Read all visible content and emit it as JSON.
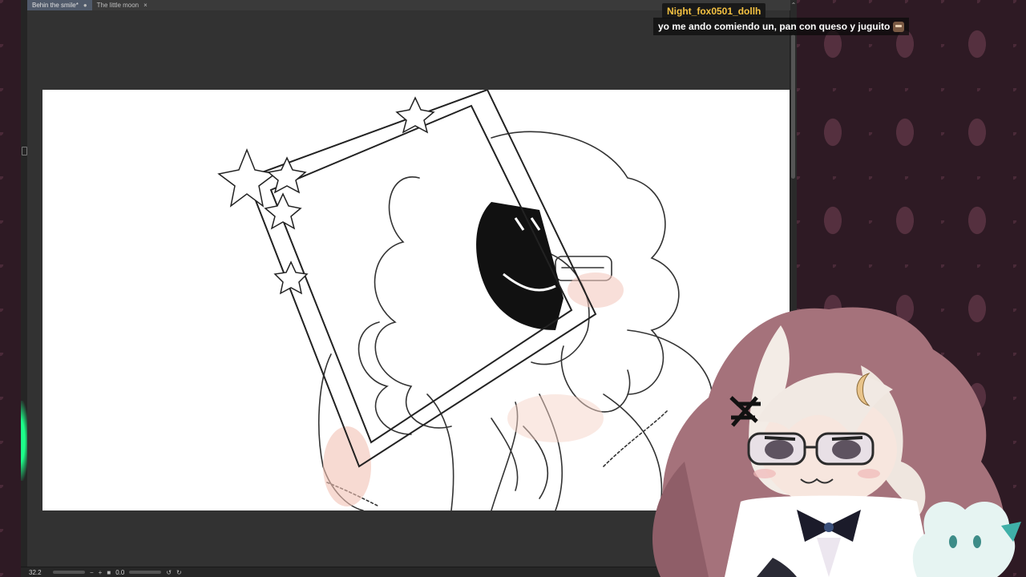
{
  "tabs": [
    {
      "label": "Behin the smile*",
      "close": "●"
    },
    {
      "label": "The little moon",
      "close": "×"
    }
  ],
  "scroll_up_glyph": "⌃",
  "status": {
    "zoom": "32.2",
    "zoom_out": "−",
    "zoom_in": "+",
    "fit_icon": "■",
    "rotation": "0.0"
  },
  "chat": {
    "username": "Night_fox0501_dollh",
    "message": "yo me ando comiendo un, pan con queso y juguito",
    "username_color": "#f5c242"
  },
  "colors": {
    "wallpaper": "#2e1a24",
    "app_bg": "#2f2f2f",
    "active_tab": "#505a6a"
  }
}
